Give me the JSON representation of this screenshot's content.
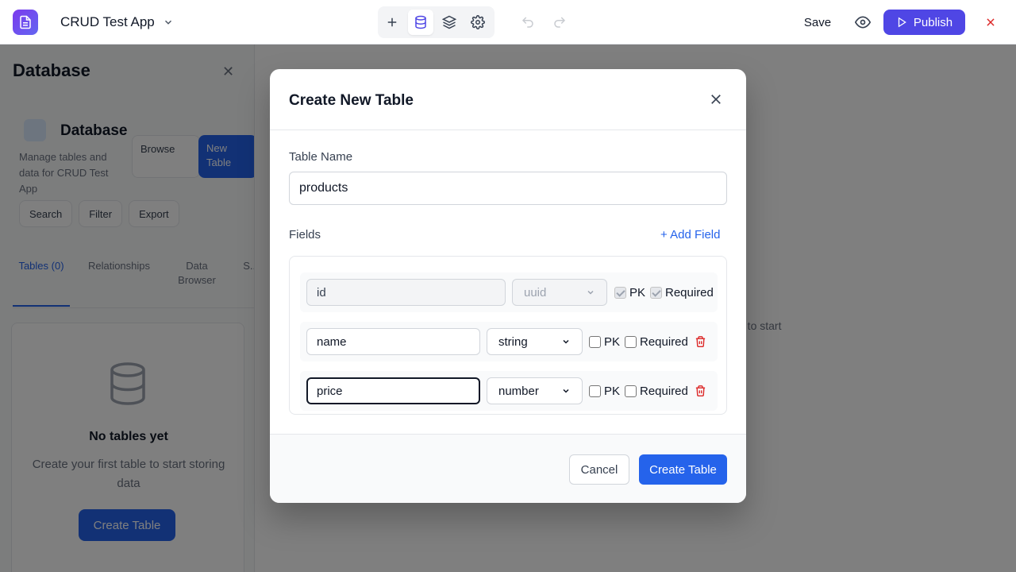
{
  "header": {
    "app_name": "CRUD Test App",
    "save_label": "Save",
    "publish_label": "Publish",
    "colors": {
      "brand": "#4f46e5",
      "close": "#dc2626"
    }
  },
  "sidebar": {
    "heading": "Database",
    "card_title": "Database",
    "card_description": "Manage tables and data for CRUD Test App",
    "browse_label": "Browse",
    "new_table_label": "New Table",
    "actions": [
      "Search",
      "Filter",
      "Export"
    ],
    "tabs": [
      "Tables (0)",
      "Relationships",
      "Data Browser",
      "S..."
    ],
    "empty_title": "No tables yet",
    "empty_description": "Create your first table to start storing data",
    "empty_button": "Create Table",
    "main_hint": "e to start"
  },
  "modal": {
    "title": "Create New Table",
    "table_name_label": "Table Name",
    "table_name_value": "products",
    "fields_label": "Fields",
    "add_field_label": "+ Add Field",
    "fields": [
      {
        "name": "id",
        "type": "uuid",
        "pk": true,
        "required": true,
        "locked": true
      },
      {
        "name": "name",
        "type": "string",
        "pk": false,
        "required": false,
        "locked": false
      },
      {
        "name": "price",
        "type": "number",
        "pk": false,
        "required": false,
        "locked": false
      }
    ],
    "pk_label": "PK",
    "required_label": "Required",
    "cancel_label": "Cancel",
    "create_label": "Create Table",
    "colors": {
      "primary": "#2563eb",
      "danger": "#dc2626"
    }
  }
}
